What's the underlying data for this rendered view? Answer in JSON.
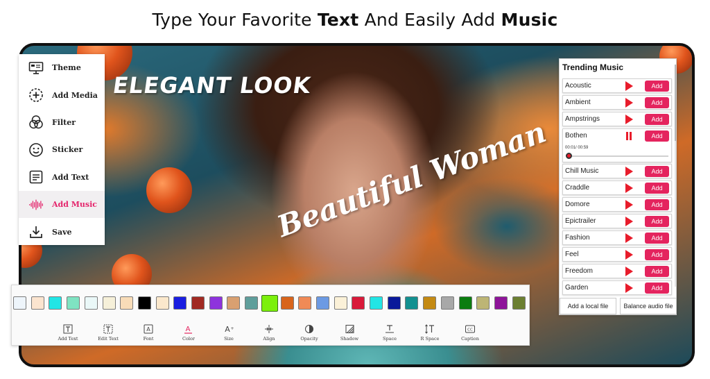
{
  "headline": {
    "prefix": "Type Your Favorite",
    "strong1": "Text",
    "middle": "And Easily Add",
    "strong2": "Music"
  },
  "canvas": {
    "text_1": "ELEGANT LOOK",
    "text_2": "Beautiful Woman"
  },
  "side_menu": {
    "items": [
      {
        "label": "Theme",
        "icon": "monitor-icon",
        "active": false
      },
      {
        "label": "Add Media",
        "icon": "add-circle-icon",
        "active": false
      },
      {
        "label": "Filter",
        "icon": "filter-circles-icon",
        "active": false
      },
      {
        "label": "Sticker",
        "icon": "smiley-icon",
        "active": false
      },
      {
        "label": "Add Text",
        "icon": "text-lines-icon",
        "active": false
      },
      {
        "label": "Add Music",
        "icon": "waveform-icon",
        "active": true
      },
      {
        "label": "Save",
        "icon": "download-icon",
        "active": false
      }
    ]
  },
  "music_panel": {
    "title": "Trending Music",
    "add_label": "Add",
    "tracks": [
      {
        "name": "Acoustic",
        "state": "stopped"
      },
      {
        "name": "Ambient",
        "state": "stopped"
      },
      {
        "name": "Ampstrings",
        "state": "stopped"
      },
      {
        "name": "Bothen",
        "state": "playing",
        "time": "00:01/ 00:59"
      },
      {
        "name": "Chill Music",
        "state": "stopped"
      },
      {
        "name": "Craddle",
        "state": "stopped"
      },
      {
        "name": "Domore",
        "state": "stopped"
      },
      {
        "name": "Epictrailer",
        "state": "stopped"
      },
      {
        "name": "Fashion",
        "state": "stopped"
      },
      {
        "name": "Feel",
        "state": "stopped"
      },
      {
        "name": "Freedom",
        "state": "stopped"
      },
      {
        "name": "Garden",
        "state": "stopped"
      }
    ],
    "add_local_label": "Add a local file",
    "balance_label": "Balance audio file",
    "accent_color": "#e4245e",
    "play_color": "#e81c2b"
  },
  "toolbar": {
    "swatches": [
      "#eef5fb",
      "#fbe4cf",
      "#22e5e5",
      "#7fe3c2",
      "#eaf8f8",
      "#f6f0d9",
      "#f8dcb8",
      "#000000",
      "#fbe8cc",
      "#1a1ee0",
      "#a12a22",
      "#8e33dd",
      "#d9a071",
      "#5f9e9b",
      "#7cf00c",
      "#d8641b",
      "#f08a56",
      "#6c9ae3",
      "#fbf1d8",
      "#d91a3a",
      "#22e5e5",
      "#0a1a9a",
      "#139090",
      "#c48a13",
      "#a8a8a8",
      "#0b7d10",
      "#bdb575",
      "#8e1499",
      "#6b7f31"
    ],
    "selected_swatch": 14,
    "tools": [
      {
        "label": "Add Text",
        "icon": "add-text-icon"
      },
      {
        "label": "Edit Text",
        "icon": "edit-text-icon"
      },
      {
        "label": "Font",
        "icon": "font-icon"
      },
      {
        "label": "Color",
        "icon": "color-icon",
        "active": true
      },
      {
        "label": "Size",
        "icon": "size-icon"
      },
      {
        "label": "Align",
        "icon": "align-icon"
      },
      {
        "label": "Opacity",
        "icon": "opacity-icon"
      },
      {
        "label": "Shadow",
        "icon": "shadow-icon"
      },
      {
        "label": "Space",
        "icon": "space-icon"
      },
      {
        "label": "R Space",
        "icon": "row-space-icon"
      },
      {
        "label": "Caption",
        "icon": "caption-icon"
      }
    ]
  }
}
